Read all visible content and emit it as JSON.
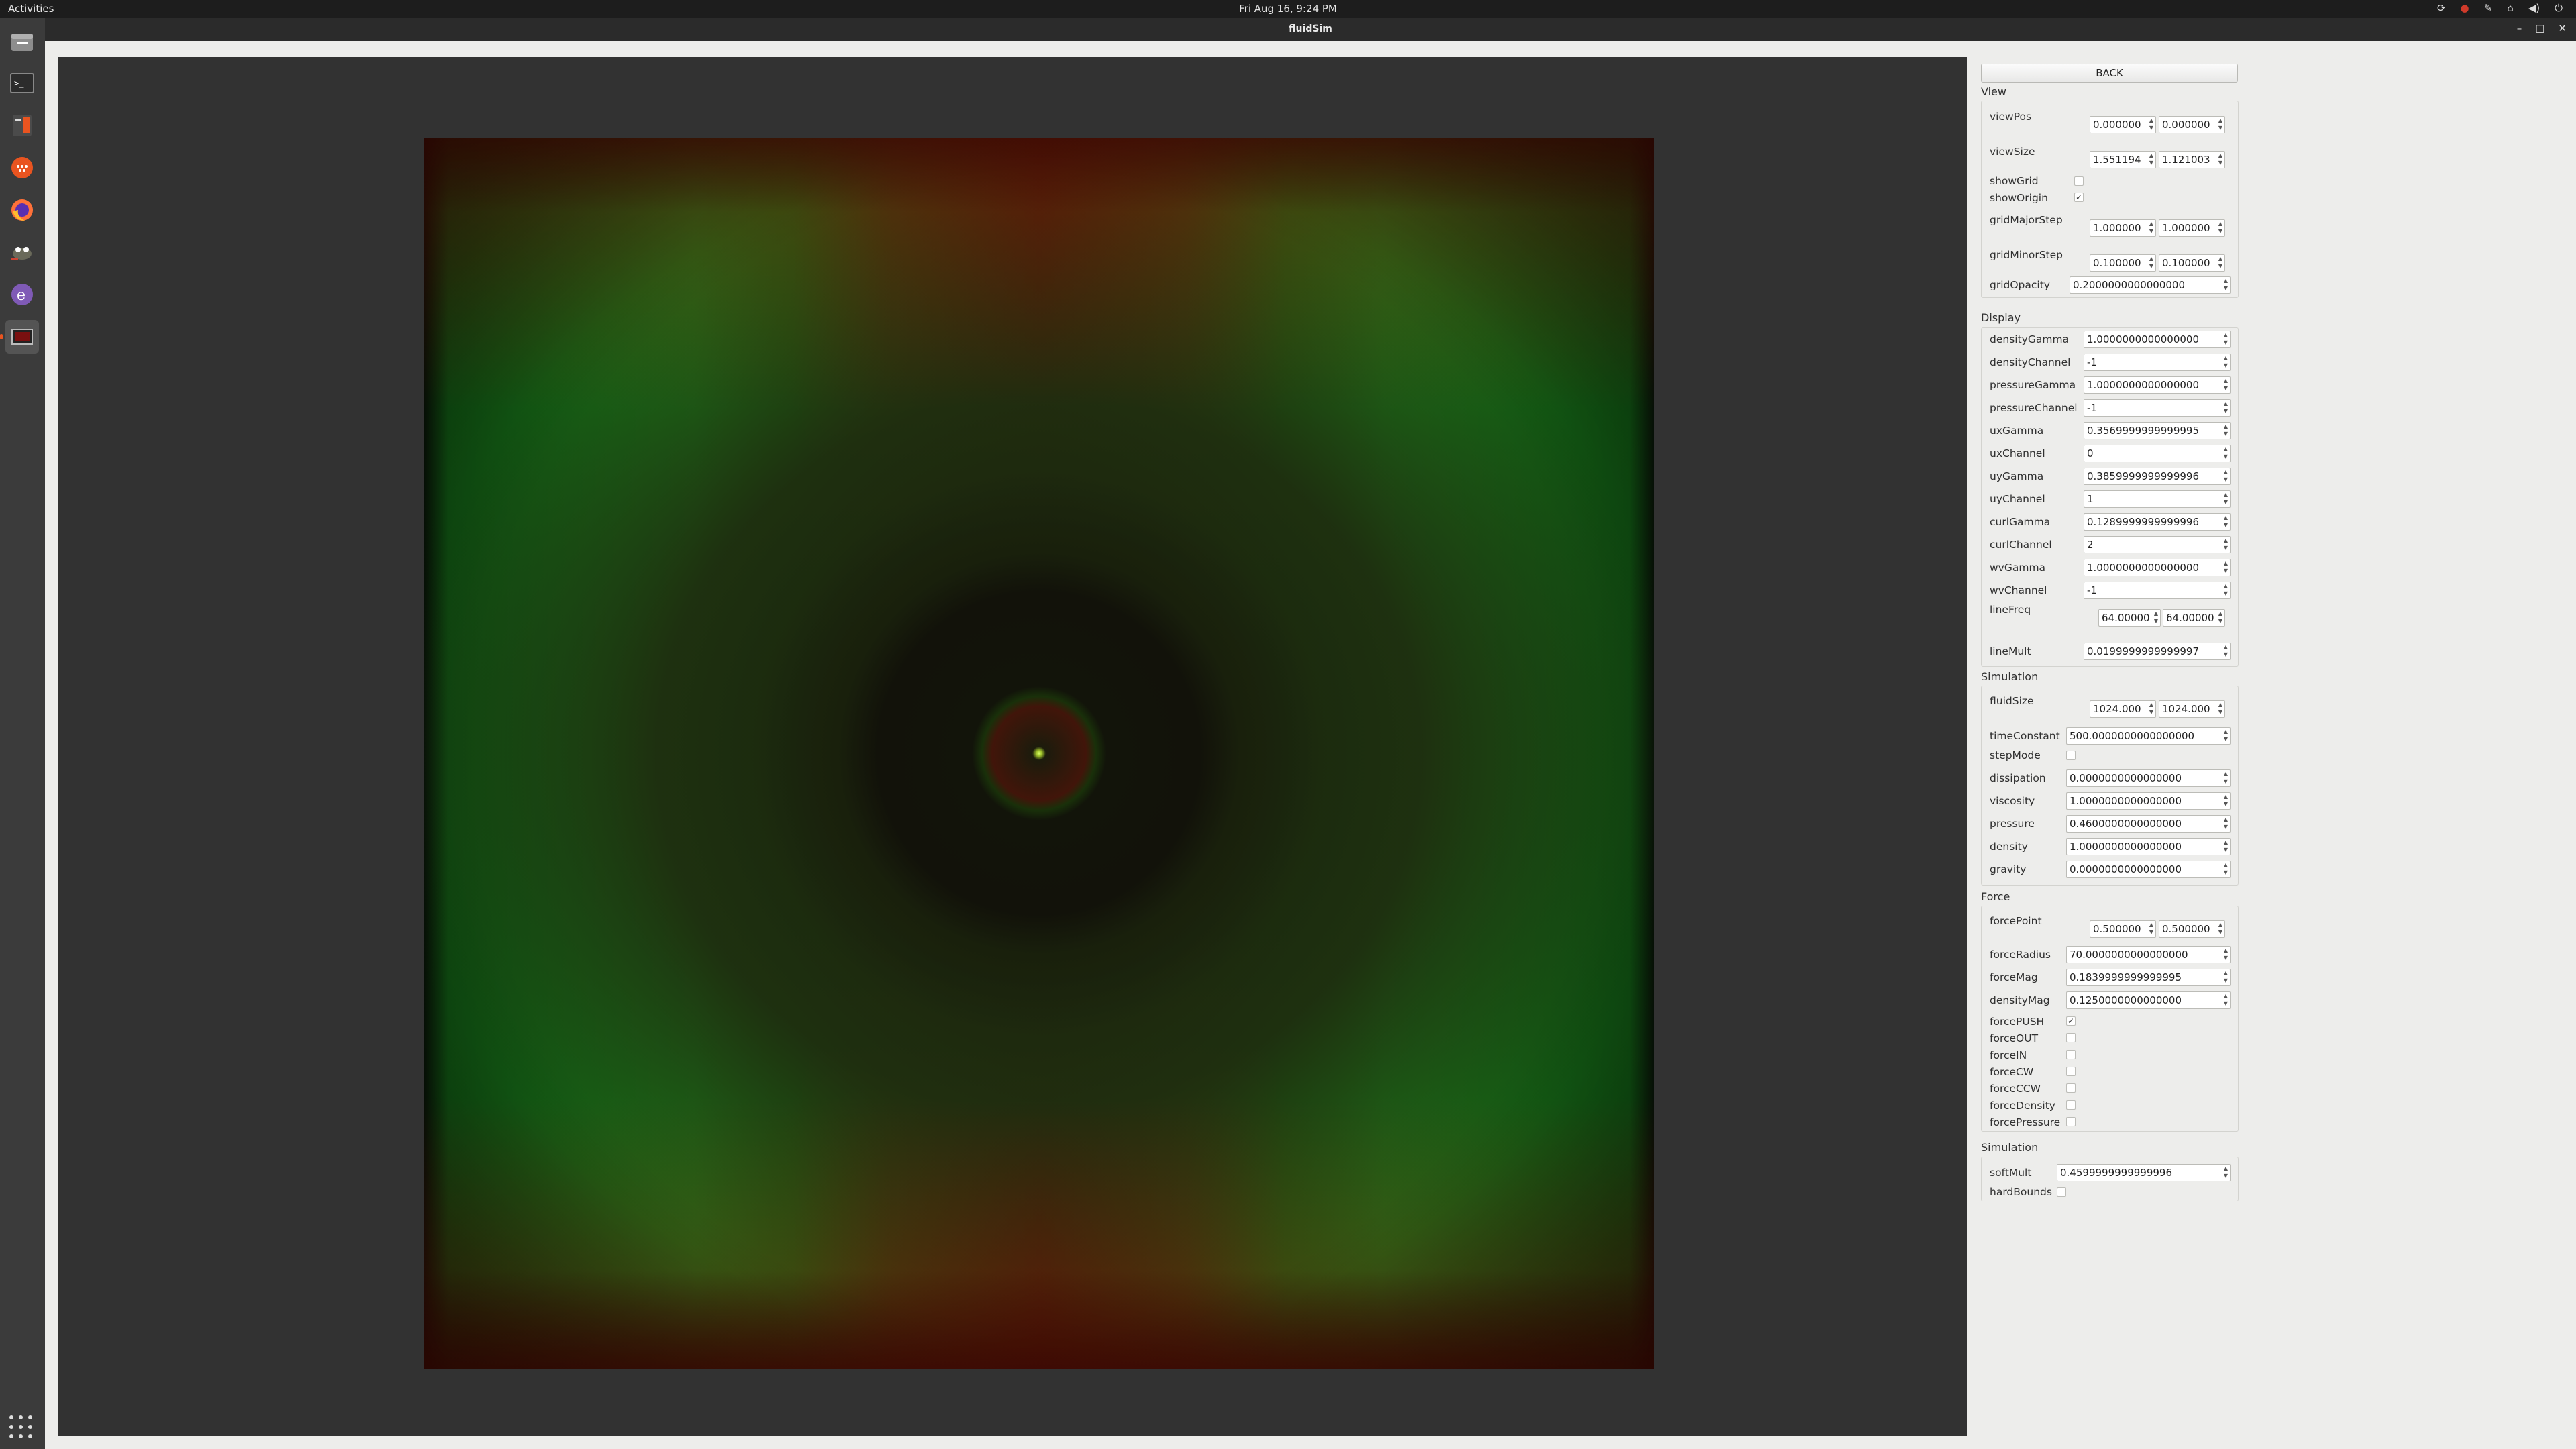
{
  "topbar": {
    "activities": "Activities",
    "clock": "Fri Aug 16,  9:24 PM"
  },
  "dock": {
    "icons": [
      "files-icon",
      "terminal-icon",
      "calculator-icon",
      "network-icon",
      "firefox-icon",
      "gimp-icon",
      "emacs-icon",
      "screenshot-icon"
    ]
  },
  "window": {
    "title": "fluidSim"
  },
  "panel": {
    "back_label": "BACK",
    "view": {
      "title": "View",
      "viewPos_label": "viewPos",
      "viewPos": [
        "0.000000",
        "0.000000"
      ],
      "viewSize_label": "viewSize",
      "viewSize": [
        "1.551194",
        "1.121003"
      ],
      "showGrid_label": "showGrid",
      "showGrid": false,
      "showOrigin_label": "showOrigin",
      "showOrigin": true,
      "gridMajorStep_label": "gridMajorStep",
      "gridMajorStep": [
        "1.000000",
        "1.000000"
      ],
      "gridMinorStep_label": "gridMinorStep",
      "gridMinorStep": [
        "0.100000",
        "0.100000"
      ],
      "gridOpacity_label": "gridOpacity",
      "gridOpacity": "0.2000000000000000"
    },
    "display": {
      "title": "Display",
      "rows": [
        {
          "label": "densityGamma",
          "value": "1.0000000000000000"
        },
        {
          "label": "densityChannel",
          "value": "-1"
        },
        {
          "label": "pressureGamma",
          "value": "1.0000000000000000"
        },
        {
          "label": "pressureChannel",
          "value": "-1"
        },
        {
          "label": "uxGamma",
          "value": "0.3569999999999995"
        },
        {
          "label": "uxChannel",
          "value": "0"
        },
        {
          "label": "uyGamma",
          "value": "0.3859999999999996"
        },
        {
          "label": "uyChannel",
          "value": "1"
        },
        {
          "label": "curlGamma",
          "value": "0.1289999999999996"
        },
        {
          "label": "curlChannel",
          "value": "2"
        },
        {
          "label": "wvGamma",
          "value": "1.0000000000000000"
        },
        {
          "label": "wvChannel",
          "value": "-1"
        }
      ],
      "lineFreq_label": "lineFreq",
      "lineFreq": [
        "64.00000",
        "64.00000"
      ],
      "lineMult_label": "lineMult",
      "lineMult": "0.0199999999999997"
    },
    "simulation": {
      "title": "Simulation",
      "fluidSize_label": "fluidSize",
      "fluidSize": [
        "1024.000",
        "1024.000"
      ],
      "timeConstant_label": "timeConstant",
      "timeConstant": "500.0000000000000000",
      "stepMode_label": "stepMode",
      "stepMode": false,
      "rows": [
        {
          "label": "dissipation",
          "value": "0.0000000000000000"
        },
        {
          "label": "viscosity",
          "value": "1.0000000000000000"
        },
        {
          "label": "pressure",
          "value": "0.4600000000000000"
        },
        {
          "label": "density",
          "value": "1.0000000000000000"
        },
        {
          "label": "gravity",
          "value": "0.0000000000000000"
        }
      ]
    },
    "force": {
      "title": "Force",
      "forcePoint_label": "forcePoint",
      "forcePoint": [
        "0.500000",
        "0.500000"
      ],
      "rows": [
        {
          "label": "forceRadius",
          "value": "70.0000000000000000"
        },
        {
          "label": "forceMag",
          "value": "0.1839999999999995"
        },
        {
          "label": "densityMag",
          "value": "0.1250000000000000"
        }
      ],
      "checks": [
        {
          "label": "forcePUSH",
          "checked": true
        },
        {
          "label": "forceOUT",
          "checked": false
        },
        {
          "label": "forceIN",
          "checked": false
        },
        {
          "label": "forceCW",
          "checked": false
        },
        {
          "label": "forceCCW",
          "checked": false
        },
        {
          "label": "forceDensity",
          "checked": false
        },
        {
          "label": "forcePressure",
          "checked": false
        }
      ]
    },
    "simulation2": {
      "title": "Simulation",
      "softMult_label": "softMult",
      "softMult": "0.4599999999999996",
      "hardBounds_label": "hardBounds",
      "hardBounds": false
    }
  }
}
